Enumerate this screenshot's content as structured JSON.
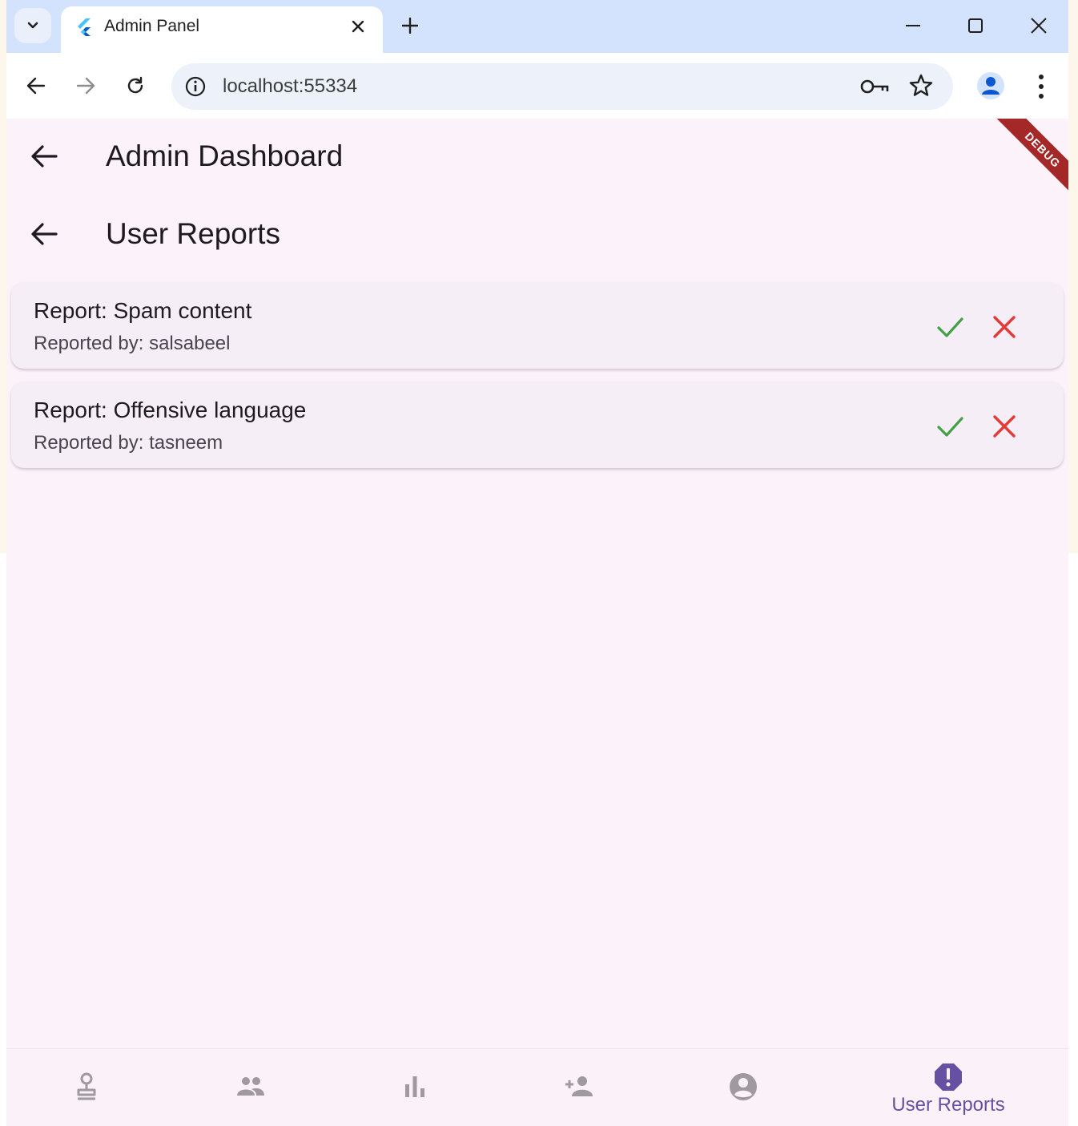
{
  "browser": {
    "tab_title": "Admin Panel",
    "url": "localhost:55334"
  },
  "app": {
    "appbars": [
      {
        "title": "Admin Dashboard"
      },
      {
        "title": "User Reports"
      }
    ],
    "debug_banner": "DEBUG",
    "reports": [
      {
        "title": "Report: Spam content",
        "reporter": "Reported by: salsabeel"
      },
      {
        "title": "Report: Offensive language",
        "reporter": "Reported by: tasneem"
      }
    ],
    "bottom_nav": {
      "active_label": "User Reports",
      "items": [
        "stamp-icon",
        "group-icon",
        "bar-chart-icon",
        "person-add-icon",
        "account-circle-icon",
        "report-icon"
      ]
    }
  },
  "colors": {
    "accept": "#43a047",
    "reject": "#e53935",
    "nav_active": "#6750a4",
    "nav_inactive": "#9e9aa0",
    "app_background": "#fcf2fa"
  }
}
